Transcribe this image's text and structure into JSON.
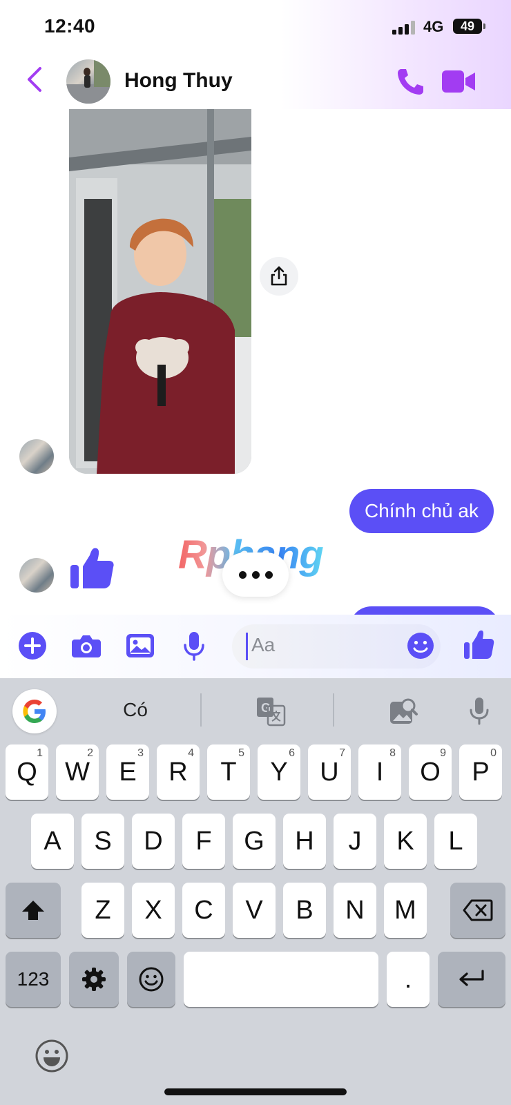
{
  "status": {
    "time": "12:40",
    "network": "4G",
    "battery": "49"
  },
  "header": {
    "contact_name": "Hong Thuy"
  },
  "messages": {
    "outgoing_text": "Chính chủ ak"
  },
  "watermark": "Rphang",
  "composer": {
    "placeholder": "Aa"
  },
  "keyboard": {
    "suggestion": "Có",
    "row1": [
      {
        "l": "Q",
        "n": "1"
      },
      {
        "l": "W",
        "n": "2"
      },
      {
        "l": "E",
        "n": "3"
      },
      {
        "l": "R",
        "n": "4"
      },
      {
        "l": "T",
        "n": "5"
      },
      {
        "l": "Y",
        "n": "6"
      },
      {
        "l": "U",
        "n": "7"
      },
      {
        "l": "I",
        "n": "8"
      },
      {
        "l": "O",
        "n": "9"
      },
      {
        "l": "P",
        "n": "0"
      }
    ],
    "row2": [
      "A",
      "S",
      "D",
      "F",
      "G",
      "H",
      "J",
      "K",
      "L"
    ],
    "row3": [
      "Z",
      "X",
      "C",
      "V",
      "B",
      "N",
      "M"
    ],
    "numbers_key": "123",
    "period_key": "."
  },
  "colors": {
    "accent": "#5b4ff6",
    "header_icons": "#a23cf2",
    "keyboard_bg": "#d1d4da"
  },
  "icons": [
    "back-chevron-icon",
    "phone-icon",
    "video-camera-icon",
    "share-icon",
    "like-icon",
    "plus-icon",
    "camera-icon",
    "image-icon",
    "microphone-icon",
    "emoji-icon",
    "google-icon",
    "translate-icon",
    "image-search-icon",
    "shift-icon",
    "backspace-icon",
    "settings-icon",
    "return-icon"
  ]
}
